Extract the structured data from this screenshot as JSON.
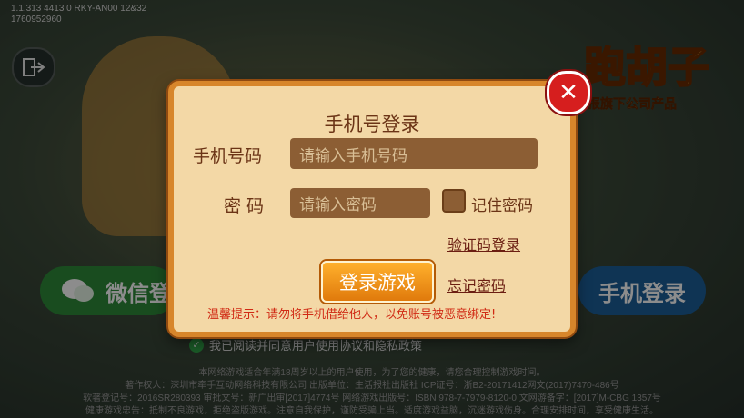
{
  "version_line1": "1.1.313  4413  0  RKY-AN00  12&32",
  "version_line2": "1760952960",
  "brand": {
    "title": "跑胡子",
    "subtitle": "江日报旗下公司产品"
  },
  "background_buttons": {
    "wechat_label": "微信登",
    "phone_label": "手机登录"
  },
  "agreement_text": "我已阅读并同意用户使用协议和隐私政策",
  "footer": [
    "本网络游戏适合年满18周岁以上的用户使用，为了您的健康，请您合理控制游戏时间。",
    "著作权人：深圳市牵手互动网络科技有限公司 出版单位：生活报社出版社 ICP证号：浙B2-20171412网文(2017)7470-486号",
    "软著登记号：2016SR280393 审批文号：新广出审[2017]4774号 网络游戏出版号：ISBN 978-7-7979-8120-0 文网游备字：[2017]M-CBG 1357号",
    "健康游戏忠告：抵制不良游戏，拒绝盗版游戏。注意自我保护，谨防受骗上当。适度游戏益脑，沉迷游戏伤身。合理安排时间，享受健康生活。"
  ],
  "dialog": {
    "title": "手机号登录",
    "phone_label": "手机号码",
    "phone_placeholder": "请输入手机号码",
    "password_label": "密 码",
    "password_placeholder": "请输入密码",
    "remember_label": "记住密码",
    "sms_login_link": "验证码登录",
    "login_button": "登录游戏",
    "forgot_link": "忘记密码",
    "tip": "温馨提示：请勿将手机借给他人，以免账号被恶意绑定!"
  },
  "colors": {
    "accent": "#f0901a",
    "close": "#d61e1e",
    "panel": "#f3d8a6"
  }
}
